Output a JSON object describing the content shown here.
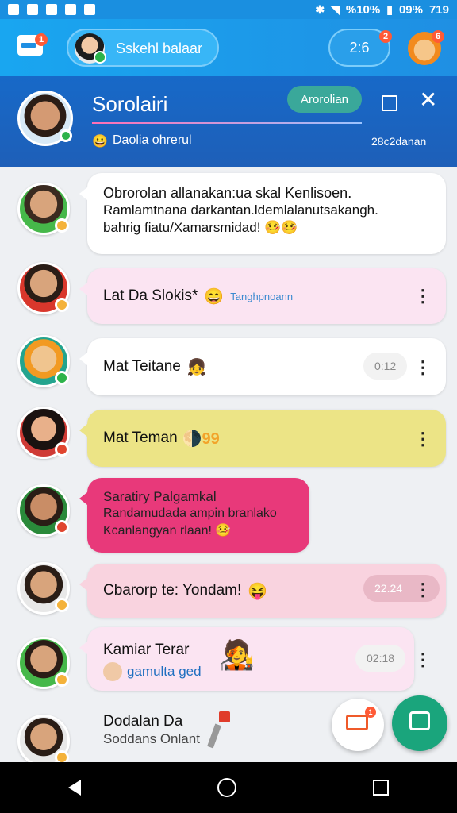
{
  "status_bar": {
    "indicators": "%10%",
    "battery": "09%",
    "time": "719"
  },
  "top_bar": {
    "inbox_badge": "1",
    "search_label": "Sskehl balaar",
    "counter": "2:6",
    "counter_badge": "2",
    "profile_badge": "6"
  },
  "chat_header": {
    "name": "Sorolairi",
    "action_label": "Arorolian",
    "subtitle": "Daolia ohrerul",
    "subtitle_emoji": "😀",
    "time": "28c2danan"
  },
  "messages": [
    {
      "lines": [
        "Obrorolan allanakan:ua skal Kenlisoen.",
        "Ramlamtnana darkantan.ldemlalanutsakangh.",
        "bahrig fiatu/Xamarsmidad! 🤒🤒"
      ],
      "bg": "#ffffff"
    },
    {
      "title": "Lat Da Slokis*",
      "emoji": "😄",
      "tag": "Tanghpnoann",
      "bg": "#fbe4f2"
    },
    {
      "title": "Mat Teitane",
      "emoji": "👧",
      "time": "0:12",
      "bg": "#ffffff"
    },
    {
      "title": "Mat Teman",
      "emoji": "🌗99",
      "bg": "#ece486"
    },
    {
      "title": "Saratiry Palgamkal",
      "lines": [
        "Randamudada ampin branlako",
        "Kcanlangyan rlaan! 🤒"
      ],
      "bg": "#e8397a"
    },
    {
      "title": "Cbarorp te: Yondam!",
      "emoji": "😝",
      "time": "22.24",
      "bg": "#f9d3df"
    },
    {
      "title": "Kamiar Terar",
      "link": "gamulta ged",
      "emoji": "🧑‍🎤",
      "time": "02:18",
      "bg": "#fbe4f2"
    },
    {
      "title": "Dodalan Da",
      "sub": "Soddans Onlant",
      "bg": "#eef0f3"
    }
  ],
  "fabs": {
    "secondary_badge": "1"
  },
  "colors": {
    "accent": "#1f8fe3",
    "header": "#1769c8",
    "fab": "#1aa57c"
  }
}
